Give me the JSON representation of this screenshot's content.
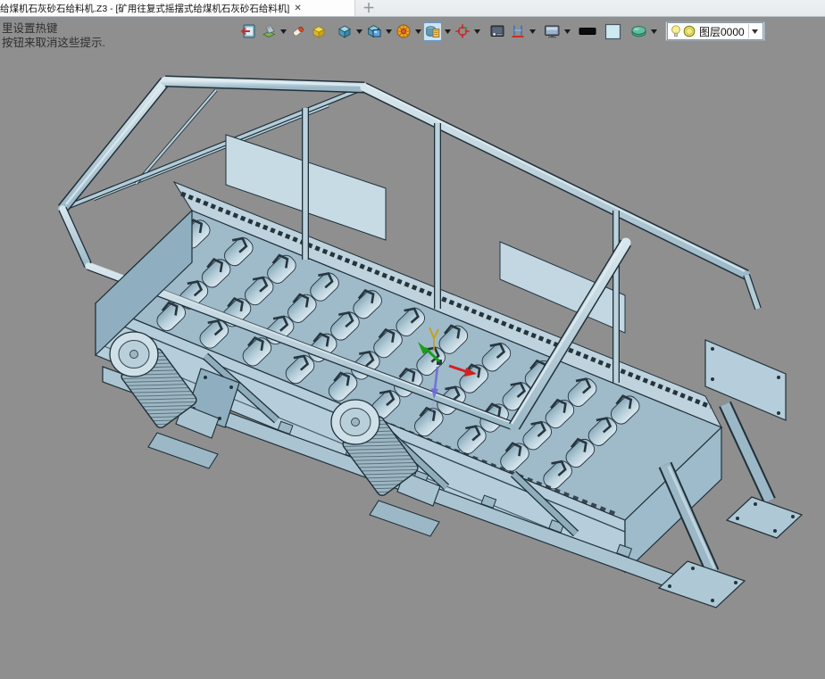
{
  "window": {
    "tab_title": "给煤机石灰砂石给料机.Z3 - [矿用往复式摇摆式给煤机石灰砂石给料机]",
    "tab_close_label": "✕",
    "new_tab_label": "＋"
  },
  "hints": {
    "line1": "里设置热键",
    "line2": "按钮来取消这些提示."
  },
  "toolbar": {
    "icons": [
      {
        "name": "exit-icon",
        "dropdown": false
      },
      {
        "name": "sheet-orient-icon",
        "dropdown": true
      },
      {
        "name": "eraser-icon",
        "dropdown": false
      },
      {
        "name": "yellow-box-icon",
        "dropdown": false
      },
      {
        "name": "shaded-cube-icon",
        "dropdown": true
      },
      {
        "name": "display-mode-cube-icon",
        "dropdown": true
      },
      {
        "name": "render-wheel-icon",
        "dropdown": true
      },
      {
        "name": "material-view-icon",
        "dropdown": true,
        "selected": true
      },
      {
        "name": "point-target-icon",
        "dropdown": true
      },
      {
        "name": "small-screen-icon",
        "dropdown": false
      },
      {
        "name": "section-view-icon",
        "dropdown": true
      },
      {
        "name": "monitor-icon",
        "dropdown": true
      },
      {
        "name": "line-color-swatch",
        "dropdown": false,
        "color": "#0c0c0c"
      },
      {
        "name": "face-color-swatch",
        "dropdown": false,
        "color": "#cde9f2"
      },
      {
        "name": "green-disc-icon",
        "dropdown": true
      }
    ],
    "layer_selector": {
      "value": "图层0000",
      "icons": [
        "bulb-icon",
        "layer-color-icon"
      ]
    }
  },
  "viewport": {
    "background_color": "#8f8f8f",
    "model_description": "矿用往复式摇摆式给煤机石灰砂石给料机 三维装配模型",
    "model_face_color": "#b2cbd8",
    "model_edge_color": "#1f3039",
    "triad_colors": {
      "x_axis": "#d42020",
      "y_axis": "#18a018",
      "z_axis": "#6868d8"
    }
  }
}
